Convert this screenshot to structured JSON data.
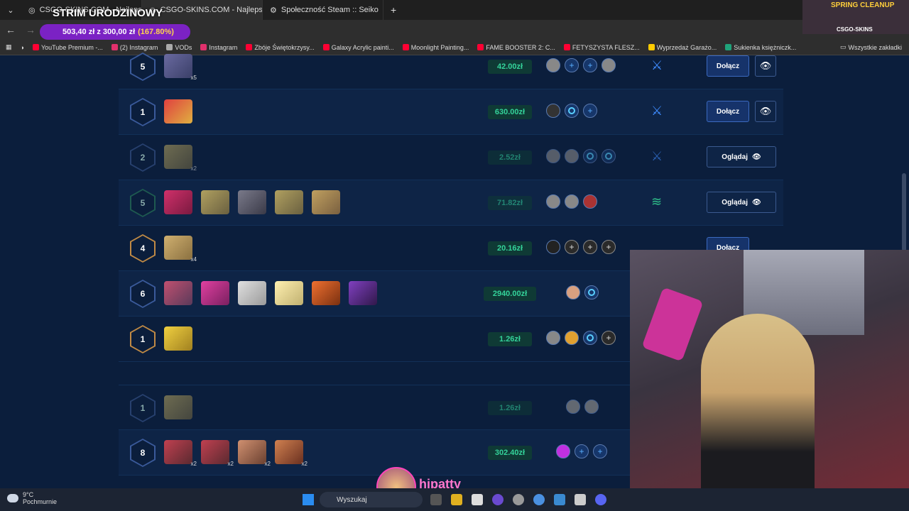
{
  "browser": {
    "tabs": [
      {
        "label": "CSGO-SKINS.COM - Najlepsze",
        "active": false
      },
      {
        "label": "CSGO-SKINS.COM - Najlepsze",
        "active": true
      },
      {
        "label": "Społeczność Steam :: Seiko",
        "active": false
      }
    ],
    "new_tab": "+",
    "bookmarks": [
      {
        "label": "YouTube Premium -...",
        "color": "#ff0033"
      },
      {
        "label": "(2) Instagram",
        "color": "#e1306c"
      },
      {
        "label": "VODs",
        "color": "#aaaaaa"
      },
      {
        "label": "Instagram",
        "color": "#e1306c"
      },
      {
        "label": "Zbóje Świętokrzysy...",
        "color": "#ff0033"
      },
      {
        "label": "Galaxy Acrylic painti...",
        "color": "#ff0033"
      },
      {
        "label": "Moonlight Painting...",
        "color": "#ff0033"
      },
      {
        "label": "FAME BOOSTER 2: C...",
        "color": "#ff0033"
      },
      {
        "label": "FETYSZYSTA FLESZ...",
        "color": "#ff0033"
      },
      {
        "label": "Wyprzedaż Garażo...",
        "color": "#ffcc00"
      },
      {
        "label": "Sukienka księżniczk...",
        "color": "#1fa37a"
      }
    ],
    "all_bookmarks": "Wszystkie zakładki"
  },
  "stream": {
    "title": "STRIM URODZINOWY",
    "donation_amount": "503,40 zł z 300,00 zł",
    "donation_pct": "(167.80%)",
    "corner_label": "SPRING CLEANUP",
    "corner_brand": "CSGO-SKINS",
    "streamer": "hipatty"
  },
  "battles": [
    {
      "players": "5",
      "price": "42.00zł",
      "action": "Dołącz",
      "mult": "x5"
    },
    {
      "players": "1",
      "price": "630.00zł",
      "action": "Dołącz",
      "mult": ""
    },
    {
      "players": "2",
      "price": "2.52zł",
      "action": "Oglądaj",
      "mult": "x2"
    },
    {
      "players": "5",
      "price": "71.82zł",
      "action": "Oglądaj",
      "mult": ""
    },
    {
      "players": "4",
      "price": "20.16zł",
      "action": "Dołącz",
      "mult": "x4"
    },
    {
      "players": "6",
      "price": "2940.00zł",
      "action": "",
      "mult": ""
    },
    {
      "players": "1",
      "price": "1.26zł",
      "action": "",
      "mult": ""
    },
    {
      "players": "1",
      "price": "1.26zł",
      "action": "",
      "mult": ""
    },
    {
      "players": "8",
      "price": "302.40zł",
      "action": "",
      "mult": "x2"
    }
  ],
  "taskbar": {
    "temp": "9°C",
    "weather": "Pochmurnie",
    "search": "Wyszukaj"
  }
}
